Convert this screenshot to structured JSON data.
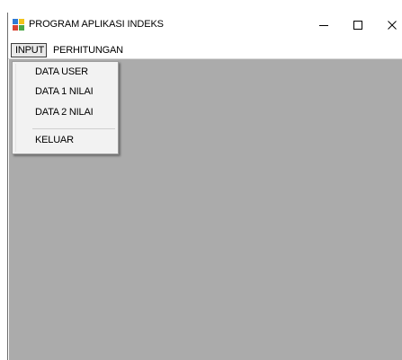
{
  "window": {
    "title": "PROGRAM APLIKASI INDEKS",
    "controls": {
      "minimize": "–",
      "maximize": "☐",
      "close": "X"
    }
  },
  "menubar": {
    "items": [
      {
        "label": "INPUT",
        "open": true
      },
      {
        "label": "PERHITUNGAN",
        "open": false
      }
    ]
  },
  "input_menu": {
    "items": [
      "DATA USER",
      "DATA 1 NILAI",
      "DATA 2 NILAI"
    ],
    "exit_label": "KELUAR"
  },
  "colors": {
    "client_area": "#ababab",
    "menu_background": "#f2f2f2",
    "highlight_border": "#3d3d3d"
  }
}
